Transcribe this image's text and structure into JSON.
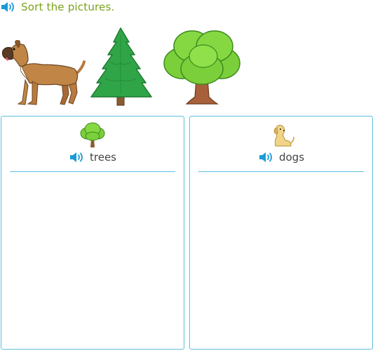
{
  "prompt": {
    "text": "Sort the pictures.",
    "audio_icon": "speaker-icon"
  },
  "pictures": [
    {
      "name": "boxer-dog",
      "category": "dogs"
    },
    {
      "name": "pine-tree",
      "category": "trees"
    },
    {
      "name": "leafy-tree",
      "category": "trees"
    }
  ],
  "bins": [
    {
      "label": "trees",
      "icon": "tree-icon"
    },
    {
      "label": "dogs",
      "icon": "dog-icon"
    }
  ],
  "colors": {
    "prompt_text": "#7aa21a",
    "speaker": "#1a9bd7",
    "bin_border": "#5cc0dd",
    "label_text": "#444444"
  }
}
